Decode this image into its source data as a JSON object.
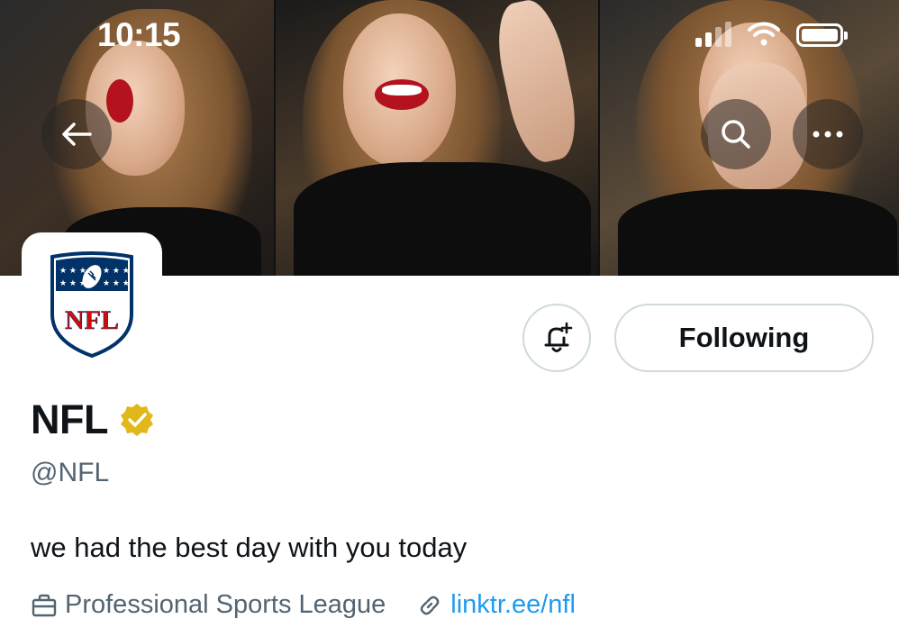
{
  "status_bar": {
    "time": "10:15",
    "battery_level": 1.0
  },
  "header": {
    "back_icon": "arrow-left-icon",
    "search_icon": "search-icon",
    "more_icon": "more-horizontal-icon"
  },
  "avatar": {
    "logo_text": "NFL",
    "logo_icon": "nfl-shield-logo"
  },
  "actions": {
    "notify_icon": "bell-plus-icon",
    "following_label": "Following"
  },
  "profile": {
    "name": "NFL",
    "verified_icon": "verified-gold-badge-icon",
    "handle": "@NFL",
    "bio": "we had the best day with you today",
    "category": "Professional Sports League",
    "category_icon": "briefcase-icon",
    "link": "linktr.ee/nfl",
    "link_icon": "link-icon"
  },
  "colors": {
    "link": "#1d9bf0",
    "secondary_text": "#536471",
    "primary_text": "#0f1419",
    "verified_gold": "#e2b719",
    "nfl_blue": "#013369",
    "nfl_red": "#d50a0a"
  }
}
